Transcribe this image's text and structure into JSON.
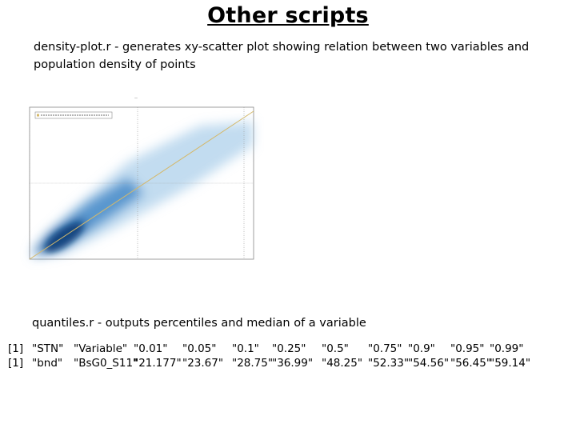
{
  "slide": {
    "title": "Other scripts",
    "density_desc": "density-plot.r  - generates  xy-scatter plot showing relation between two variables and population density of points",
    "quantiles_desc": "quantiles.r  - outputs percentiles and median of a variable"
  },
  "quantiles_output": {
    "rows": [
      {
        "index": "[1]",
        "cells": [
          "\"STN\"",
          "\"Variable\"",
          "\"0.01\"",
          "\"0.05\"",
          "\"0.1\"",
          "\"0.25\"",
          "\"0.5\"",
          "\"0.75\"",
          "\"0.9\"",
          "\"0.95\"",
          "\"0.99\""
        ]
      },
      {
        "index": "[1]",
        "cells": [
          "\"bnd\"",
          "\"BsG0_S11\"",
          "\"21.177\"",
          "\"23.67\"",
          "\"28.75\"",
          "\"36.99\"",
          "\"48.25\"",
          "\"52.33\"",
          "\"54.56\"",
          "\"56.45\"",
          "\"59.14\""
        ]
      }
    ]
  },
  "chart_data": {
    "type": "scatter",
    "title": "",
    "xlabel": "",
    "ylabel": "",
    "description": "density scatter with diagonal reference line (labels illegible in screenshot)",
    "colors": {
      "density": "#0b4f94",
      "line": "#d4b86a"
    },
    "grid": true,
    "legend": "top-left"
  }
}
